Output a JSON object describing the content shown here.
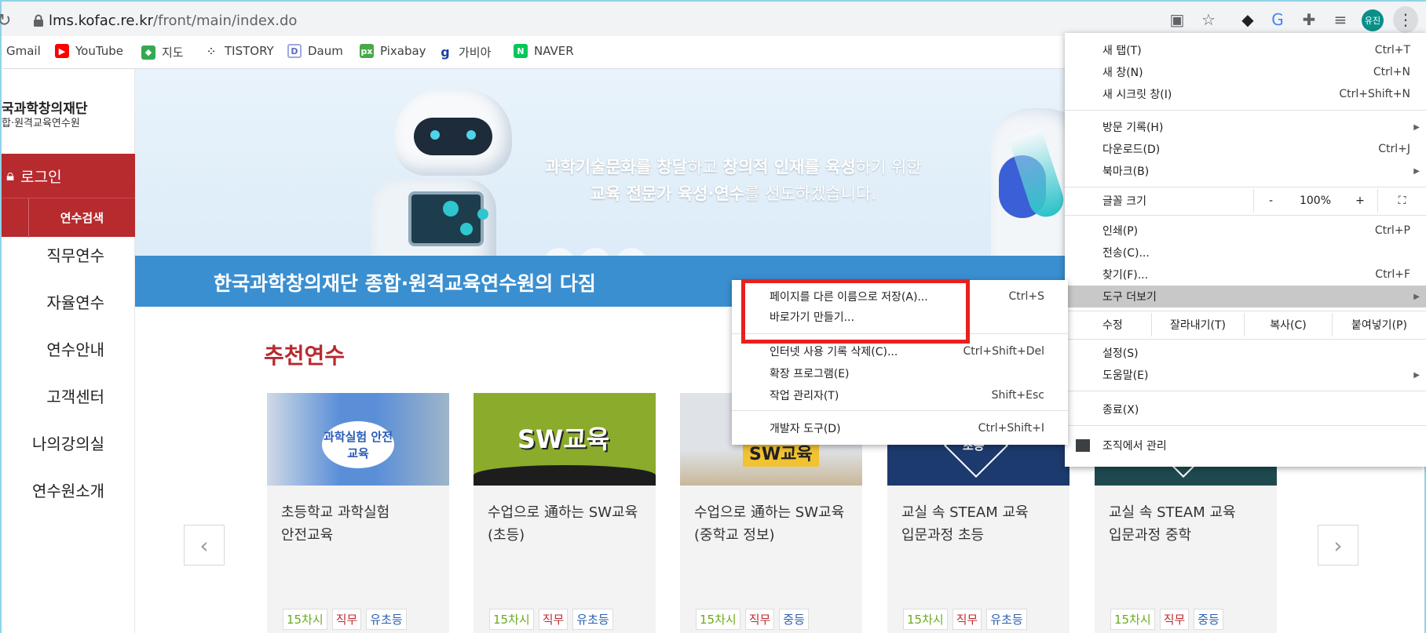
{
  "browser": {
    "url_host": "lms.kofac.re.kr",
    "url_path": "/front/main/index.do",
    "profile_label": "유진",
    "bookmarks": [
      {
        "label": "Gmail",
        "icon": "gmail-icon"
      },
      {
        "label": "YouTube",
        "icon": "youtube-icon"
      },
      {
        "label": "지도",
        "icon": "maps-icon"
      },
      {
        "label": "TISTORY",
        "icon": "tistory-icon"
      },
      {
        "label": "Daum",
        "icon": "daum-icon"
      },
      {
        "label": "Pixabay",
        "icon": "pixabay-icon"
      },
      {
        "label": "가비아",
        "icon": "gabia-icon"
      },
      {
        "label": "NAVER",
        "icon": "naver-icon"
      }
    ]
  },
  "site": {
    "org_line1": "국과학창의재단",
    "org_line2": "합·원격교육연수원",
    "login_label": "로그인",
    "search_label": "연수검색",
    "nav": [
      "직무연수",
      "자율연수",
      "연수안내",
      "고객센터",
      "나의강의실",
      "연수원소개"
    ],
    "banner": {
      "line1_a": "과학기술문화를 창달",
      "line1_b": "하고 ",
      "line1_c": "창의적 인재를 육성",
      "line1_d": "하기 위한",
      "line2_a": "교육 전문가 육성·연수",
      "line2_b": "를 선도하겠습니다.",
      "strip": "한국과학창의재단 종합·원격교육연수원의 다짐"
    },
    "recommend_title": "추천연수",
    "cards": [
      {
        "title1": "초등학교 과학실험",
        "title2": "안전교육",
        "tags": [
          "15차시",
          "직무",
          "유초등"
        ],
        "thumb": "과학실험 안전교육"
      },
      {
        "title1": "수업으로 通하는 SW교육",
        "title2": "(초등)",
        "tags": [
          "15차시",
          "직무",
          "유초등"
        ],
        "thumb": "SW교육"
      },
      {
        "title1": "수업으로 通하는 SW교육",
        "title2": "(중학교 정보)",
        "tags": [
          "15차시",
          "직무",
          "중등"
        ],
        "thumb": "SW교육"
      },
      {
        "title1": "교실 속 STEAM 교육",
        "title2": "입문과정 초등",
        "tags": [
          "15차시",
          "직무",
          "유초등"
        ],
        "thumb": "초등"
      },
      {
        "title1": "교실 속 STEAM 교육",
        "title2": "입문과정 중학",
        "tags": [
          "15차시",
          "직무",
          "중등"
        ],
        "thumb": ""
      }
    ]
  },
  "chrome_menu": {
    "new_tab": "새 탭(T)",
    "new_tab_sc": "Ctrl+T",
    "new_window": "새 창(N)",
    "new_window_sc": "Ctrl+N",
    "incognito": "새 시크릿 창(I)",
    "incognito_sc": "Ctrl+Shift+N",
    "history": "방문 기록(H)",
    "downloads": "다운로드(D)",
    "downloads_sc": "Ctrl+J",
    "bookmarks": "북마크(B)",
    "zoom_label": "글꼴 크기",
    "zoom_minus": "-",
    "zoom_value": "100%",
    "zoom_plus": "+",
    "print": "인쇄(P)",
    "print_sc": "Ctrl+P",
    "cast": "전송(C)...",
    "find": "찾기(F)...",
    "find_sc": "Ctrl+F",
    "more_tools": "도구 더보기",
    "edit_label": "수정",
    "cut": "잘라내기(T)",
    "copy": "복사(C)",
    "paste": "붙여넣기(P)",
    "settings": "설정(S)",
    "help": "도움말(E)",
    "exit": "종료(X)",
    "managed": "조직에서 관리"
  },
  "tools_submenu": {
    "save_page": "페이지를 다른 이름으로 저장(A)...",
    "save_page_sc": "Ctrl+S",
    "create_shortcut": "바로가기 만들기...",
    "clear_data": "인터넷 사용 기록 삭제(C)...",
    "clear_data_sc": "Ctrl+Shift+Del",
    "extensions": "확장 프로그램(E)",
    "task_manager": "작업 관리자(T)",
    "task_manager_sc": "Shift+Esc",
    "devtools": "개발자 도구(D)",
    "devtools_sc": "Ctrl+Shift+I"
  },
  "colors": {
    "brand_red": "#b72a2e",
    "banner_blue": "#3a8fd0",
    "highlight_box": "#e8201e"
  }
}
